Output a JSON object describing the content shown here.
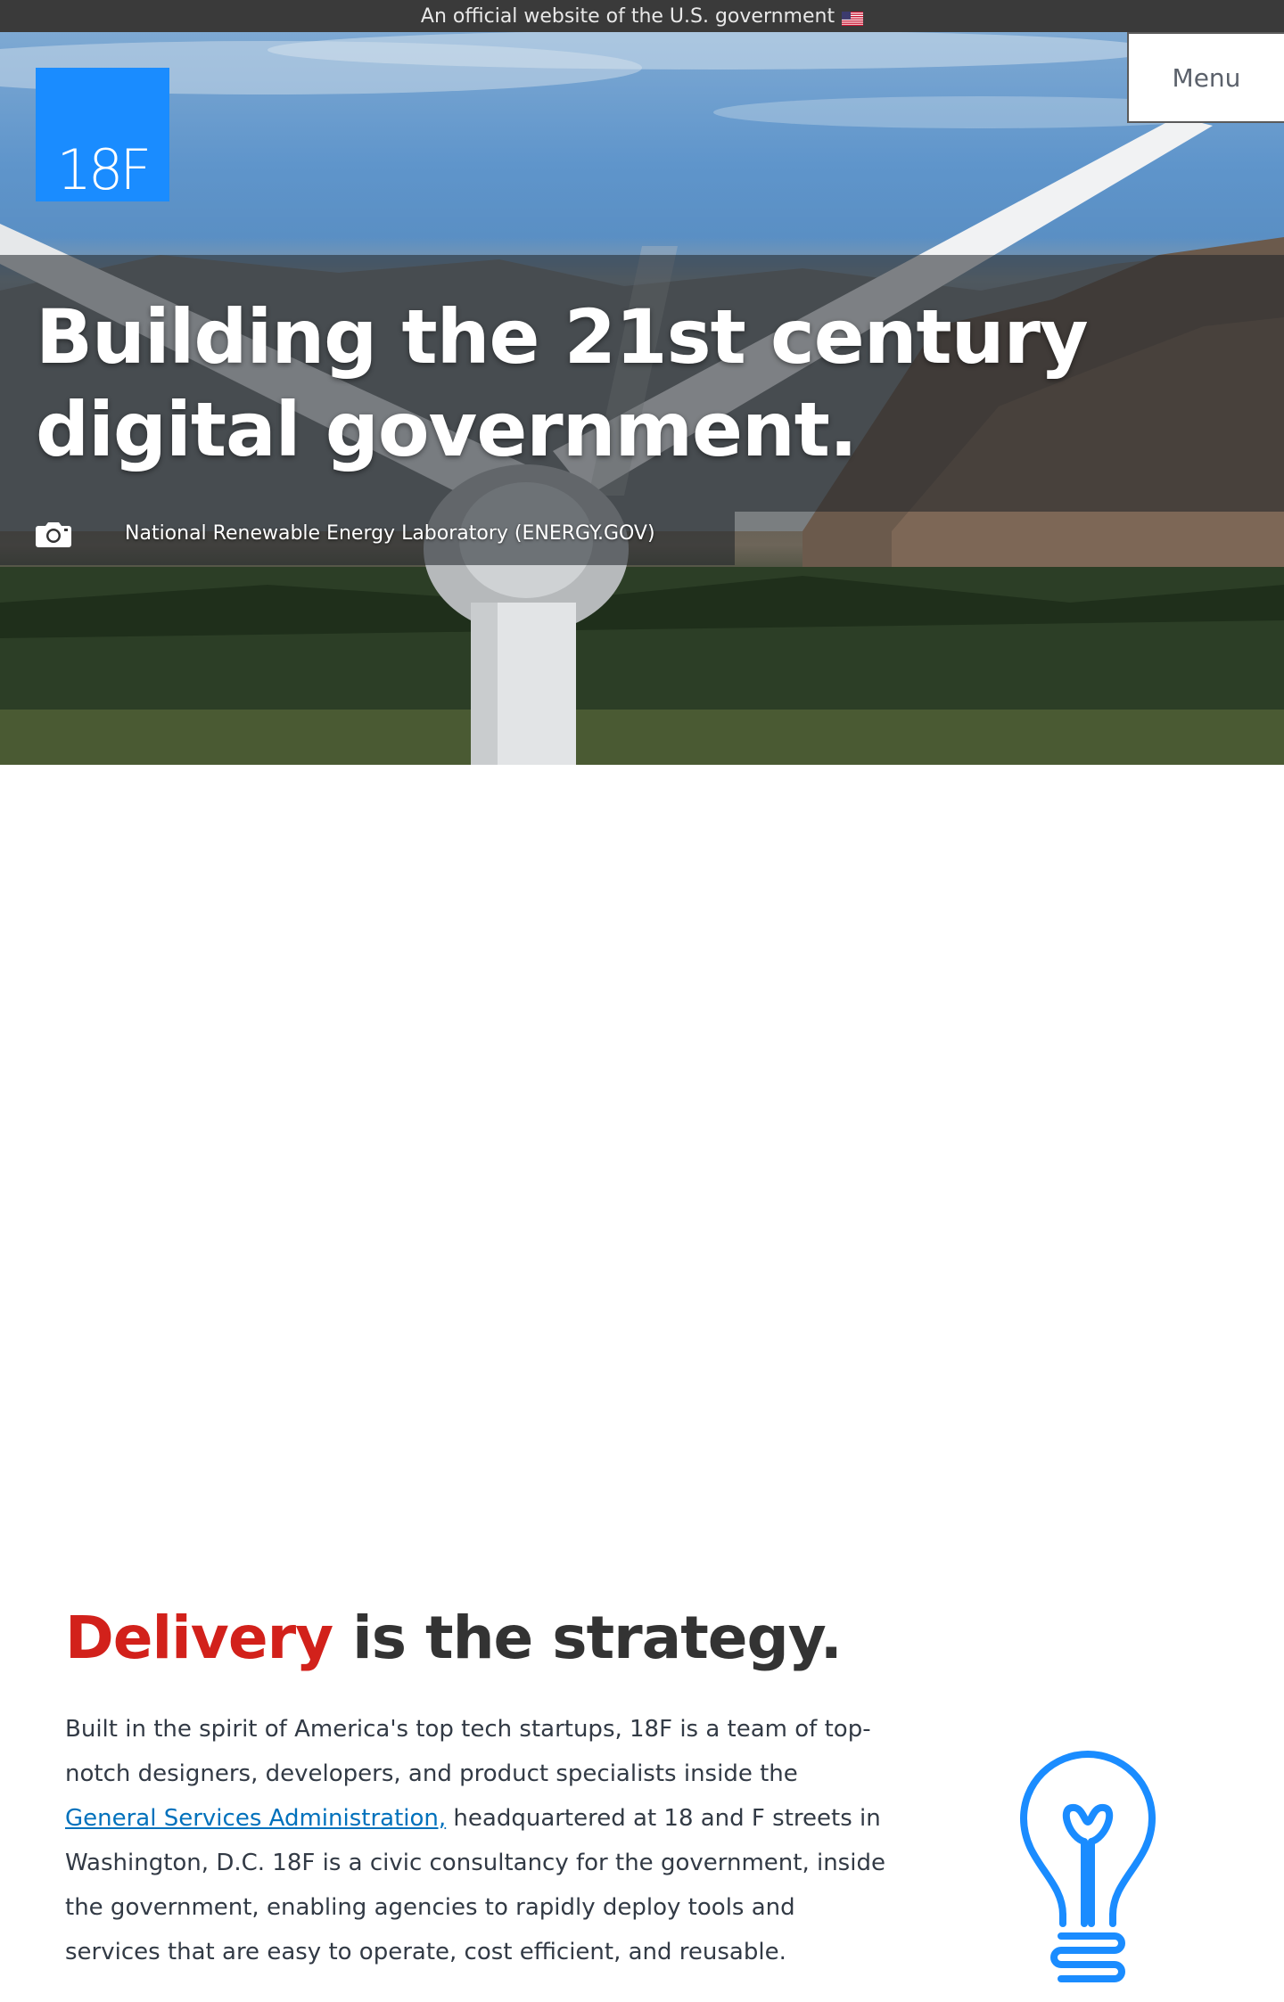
{
  "gov_banner": {
    "text": "An official website of the U.S. government",
    "flag_icon": "us-flag-icon"
  },
  "header": {
    "logo_text": "18F",
    "menu_label": "Menu",
    "brand_color": "#1a8cff"
  },
  "hero": {
    "headline": "Building the 21st century digital government.",
    "photo_credit": "National Renewable Energy Laboratory (ENERGY.GOV)",
    "camera_icon": "camera-icon"
  },
  "intro": {
    "title_accent": "Delivery",
    "title_rest": " is the strategy.",
    "accent_color": "#d2211b",
    "paragraph_before_link": "Built in the spirit of America's top tech startups, 18F is a team of top-notch designers, developers, and product specialists inside the ",
    "link_text": "General Services Administration,",
    "paragraph_after_link": " headquartered at 18 and F streets in Washington, D.C. 18F is a civic consultancy for the government, inside the government, enabling agencies to rapidly deploy tools and services that are easy to operate, cost efficient, and reusable.",
    "illustration_icon": "lightbulb-icon"
  }
}
